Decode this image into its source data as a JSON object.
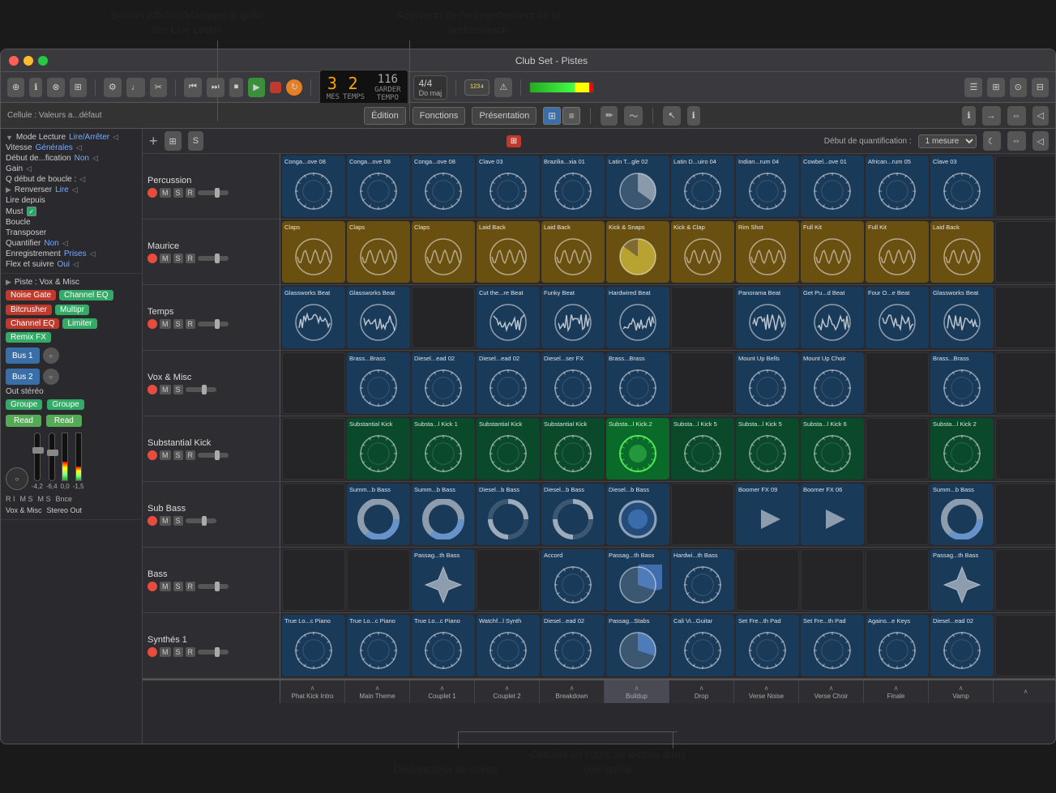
{
  "annotations": {
    "btn_label": "Bouton Afficher/Masquer\nla grille des Live Loops",
    "activation_label": "Activation de l'enregistrement\nde la performance",
    "declencheur_label": "Déclencheur\nde scène",
    "cellules_label": "Cellules en cours de\nlecture dans une scène"
  },
  "titlebar": {
    "title": "Club Set - Pistes"
  },
  "toolbar": {
    "transport": {
      "mes": "MES",
      "temps": "TEMPS",
      "tempo": "TEMPO",
      "counter_mes": "3",
      "counter_temps": "2",
      "tempo_val": "116",
      "time_sig": "4/4",
      "key": "Do maj",
      "garder": "GARDER"
    }
  },
  "sub_toolbar": {
    "edition": "Édition",
    "fonctions": "Fonctions",
    "presentation": "Présentation"
  },
  "left_panel": {
    "cellule_label": "Cellule : Valeurs a...défaut",
    "mode_lecture": "Mode Lecture",
    "mode_value": "Lire/Arrêter",
    "vitesse": "Vitesse",
    "vitesse_value": "Générales",
    "debut_modif": "Début de...fication",
    "debut_modif_value": "Non",
    "gain": "Gain",
    "q_debut": "Q début de boucle :",
    "renverser": "Renverser",
    "renverser_value": "Lire",
    "lire_depuis": "Lire depuis",
    "must": "Must",
    "boucle": "Boucle",
    "transposer": "Transposer",
    "quantifier": "Quantifier",
    "quantifier_value": "Non",
    "enregistrement": "Enregistrement",
    "enregistrement_value": "Prises",
    "flex": "Flex et suivre",
    "flex_value": "Oui",
    "piste_label": "Piste : Vox & Misc",
    "effects": [
      "Noise Gate",
      "Bitcrusher",
      "Channel EQ"
    ],
    "effects2": [
      "Channel EQ",
      "Multipr",
      "Limiter",
      "Remix FX"
    ],
    "bus1": "Bus 1",
    "bus2": "Bus 2",
    "out_stereo": "Out stéréo",
    "groupe": "Groupe",
    "read1": "Read",
    "read2": "Read",
    "val1": "-4,2",
    "val2": "-6,4",
    "val3": "0,0",
    "val4": "-1,5",
    "bottom1": "R I",
    "bottom2": "M S",
    "bottom3": "M S",
    "bounce": "Bnce",
    "track1": "Vox & Misc",
    "track2": "Stereo Out"
  },
  "quantize": {
    "label": "Début de quantification :",
    "value": "1 mesure"
  },
  "tracks": [
    {
      "name": "Percussion",
      "color": "blue",
      "cells": [
        {
          "label": "Conga...ove 08",
          "type": "blue",
          "waveform": "circle"
        },
        {
          "label": "Conga...ove 08",
          "type": "blue",
          "waveform": "circle"
        },
        {
          "label": "Conga...ove 08",
          "type": "blue",
          "waveform": "circle"
        },
        {
          "label": "Clave 03",
          "type": "blue",
          "waveform": "circle"
        },
        {
          "label": "Brazilia...xia 01",
          "type": "blue",
          "waveform": "circle"
        },
        {
          "label": "Latin T...gle 02",
          "type": "blue",
          "waveform": "pie"
        },
        {
          "label": "Latin D...uiro 04",
          "type": "blue",
          "waveform": "circle"
        },
        {
          "label": "Indian...rum 04",
          "type": "blue",
          "waveform": "circle"
        },
        {
          "label": "Cowbel...ove 01",
          "type": "blue",
          "waveform": "circle"
        },
        {
          "label": "African...rum 05",
          "type": "blue",
          "waveform": "circle"
        },
        {
          "label": "Clave 03",
          "type": "blue",
          "waveform": "circle"
        },
        {
          "label": "",
          "type": "empty"
        }
      ]
    },
    {
      "name": "Maurice",
      "color": "yellow",
      "cells": [
        {
          "label": "Claps",
          "type": "gold",
          "waveform": "wave"
        },
        {
          "label": "Claps",
          "type": "gold",
          "waveform": "wave"
        },
        {
          "label": "Claps",
          "type": "gold",
          "waveform": "wave"
        },
        {
          "label": "Laid Back",
          "type": "gold",
          "waveform": "wave"
        },
        {
          "label": "Laid Back",
          "type": "gold",
          "waveform": "wave"
        },
        {
          "label": "Kick & Snaps",
          "type": "gold",
          "waveform": "pie2"
        },
        {
          "label": "Kick & Clap",
          "type": "gold",
          "waveform": "wave"
        },
        {
          "label": "Rim Shot",
          "type": "gold",
          "waveform": "wave"
        },
        {
          "label": "Full Kit",
          "type": "gold",
          "waveform": "wave"
        },
        {
          "label": "Full Kit",
          "type": "gold",
          "waveform": "wave"
        },
        {
          "label": "Laid Back",
          "type": "gold",
          "waveform": "wave"
        },
        {
          "label": "",
          "type": "empty"
        }
      ]
    },
    {
      "name": "Temps",
      "color": "blue",
      "cells": [
        {
          "label": "Glassworks Beat",
          "type": "blue",
          "waveform": "wave2"
        },
        {
          "label": "Glassworks Beat",
          "type": "blue",
          "waveform": "wave2"
        },
        {
          "label": "",
          "type": "empty"
        },
        {
          "label": "Cut the...re Beat",
          "type": "blue",
          "waveform": "wave2"
        },
        {
          "label": "Funky Beat",
          "type": "blue",
          "waveform": "wave2"
        },
        {
          "label": "Hardwired Beat",
          "type": "blue",
          "waveform": "wave2"
        },
        {
          "label": "",
          "type": "empty"
        },
        {
          "label": "Panorama Beat",
          "type": "blue",
          "waveform": "wave2"
        },
        {
          "label": "Get Pu...d Beat",
          "type": "blue",
          "waveform": "wave2"
        },
        {
          "label": "Four O...e Beat",
          "type": "blue",
          "waveform": "wave2"
        },
        {
          "label": "Glassworks Beat",
          "type": "blue",
          "waveform": "wave2"
        },
        {
          "label": "",
          "type": "empty"
        }
      ]
    },
    {
      "name": "Vox & Misc",
      "color": "blue",
      "cells": [
        {
          "label": "",
          "type": "empty"
        },
        {
          "label": "Brass...Brass",
          "type": "blue",
          "waveform": "circle"
        },
        {
          "label": "Diesel...ead 02",
          "type": "blue",
          "waveform": "circle"
        },
        {
          "label": "Diesel...ead 02",
          "type": "blue",
          "waveform": "circle"
        },
        {
          "label": "Diesel...ser FX",
          "type": "blue",
          "waveform": "circle"
        },
        {
          "label": "Brass...Brass",
          "type": "blue",
          "waveform": "circle"
        },
        {
          "label": "",
          "type": "empty"
        },
        {
          "label": "Mount Up Bells",
          "type": "blue",
          "waveform": "circle"
        },
        {
          "label": "Mount Up Choir",
          "type": "blue",
          "waveform": "circle"
        },
        {
          "label": "",
          "type": "empty"
        },
        {
          "label": "Brass...Brass",
          "type": "blue",
          "waveform": "circle"
        },
        {
          "label": "",
          "type": "empty"
        }
      ]
    },
    {
      "name": "Substantial Kick",
      "color": "green",
      "cells": [
        {
          "label": "",
          "type": "empty"
        },
        {
          "label": "Substantial Kick",
          "type": "green",
          "waveform": "circle"
        },
        {
          "label": "Substa...l Kick 1",
          "type": "green",
          "waveform": "circle"
        },
        {
          "label": "Substantial Kick",
          "type": "green",
          "waveform": "circle"
        },
        {
          "label": "Substantial Kick",
          "type": "green",
          "waveform": "circle"
        },
        {
          "label": "Substa...l Kick.2",
          "type": "bright-green",
          "waveform": "circle-bright"
        },
        {
          "label": "Substa...l Kick 5",
          "type": "green",
          "waveform": "circle"
        },
        {
          "label": "Substa...l Kick 5",
          "type": "green",
          "waveform": "circle"
        },
        {
          "label": "Substa...l Kick 6",
          "type": "green",
          "waveform": "circle"
        },
        {
          "label": "",
          "type": "empty"
        },
        {
          "label": "Substa...l Kick 2",
          "type": "green",
          "waveform": "circle"
        },
        {
          "label": "",
          "type": "empty"
        }
      ]
    },
    {
      "name": "Sub Bass",
      "color": "blue",
      "cells": [
        {
          "label": "",
          "type": "empty"
        },
        {
          "label": "Summ...b Bass",
          "type": "blue",
          "waveform": "donut"
        },
        {
          "label": "Summ...b Bass",
          "type": "blue",
          "waveform": "donut"
        },
        {
          "label": "Diesel...b Bass",
          "type": "blue",
          "waveform": "donut-open"
        },
        {
          "label": "Diesel...b Bass",
          "type": "blue",
          "waveform": "donut-open"
        },
        {
          "label": "Diesel...b Bass",
          "type": "blue",
          "waveform": "donut-fill"
        },
        {
          "label": "",
          "type": "empty"
        },
        {
          "label": "Boomer FX 09",
          "type": "blue",
          "waveform": "play"
        },
        {
          "label": "Boomer FX 06",
          "type": "blue",
          "waveform": "play"
        },
        {
          "label": "",
          "type": "empty"
        },
        {
          "label": "Summ...b Bass",
          "type": "blue",
          "waveform": "donut"
        },
        {
          "label": "",
          "type": "empty"
        }
      ]
    },
    {
      "name": "Bass",
      "color": "blue",
      "cells": [
        {
          "label": "",
          "type": "empty"
        },
        {
          "label": "",
          "type": "empty"
        },
        {
          "label": "Passag...th Bass",
          "type": "blue",
          "waveform": "star"
        },
        {
          "label": "",
          "type": "empty"
        },
        {
          "label": "Accord",
          "type": "blue",
          "waveform": "circle"
        },
        {
          "label": "Passag...th Bass",
          "type": "blue",
          "waveform": "pie3"
        },
        {
          "label": "Hardwi...th Bass",
          "type": "blue",
          "waveform": "circle"
        },
        {
          "label": "",
          "type": "empty"
        },
        {
          "label": "",
          "type": "empty"
        },
        {
          "label": "",
          "type": "empty"
        },
        {
          "label": "Passag...th Bass",
          "type": "blue",
          "waveform": "star"
        },
        {
          "label": "",
          "type": "empty"
        }
      ]
    },
    {
      "name": "Synthés 1",
      "color": "blue",
      "cells": [
        {
          "label": "True Lo...c Piano",
          "type": "blue",
          "waveform": "circle"
        },
        {
          "label": "True Lo...c Piano",
          "type": "blue",
          "waveform": "circle"
        },
        {
          "label": "True Lo...c Piano",
          "type": "blue",
          "waveform": "circle"
        },
        {
          "label": "Watchf...l Synth",
          "type": "blue",
          "waveform": "circle"
        },
        {
          "label": "Diesel...ead 02",
          "type": "blue",
          "waveform": "circle"
        },
        {
          "label": "Passag...Stabs",
          "type": "blue",
          "waveform": "pie4"
        },
        {
          "label": "Cali Vi...Guitar",
          "type": "blue",
          "waveform": "circle"
        },
        {
          "label": "Set Fre...th Pad",
          "type": "blue",
          "waveform": "circle"
        },
        {
          "label": "Set Fre...th Pad",
          "type": "blue",
          "waveform": "circle"
        },
        {
          "label": "Agains...e Keys",
          "type": "blue",
          "waveform": "circle"
        },
        {
          "label": "Diesel...ead 02",
          "type": "blue",
          "waveform": "circle"
        },
        {
          "label": "",
          "type": "empty"
        }
      ]
    }
  ],
  "scenes": [
    {
      "name": "Phat Kick Intro",
      "active": false
    },
    {
      "name": "Main Theme",
      "active": false
    },
    {
      "name": "Couplet 1",
      "active": false
    },
    {
      "name": "Couplet 2",
      "active": false
    },
    {
      "name": "Breakdown",
      "active": false
    },
    {
      "name": "Buildup",
      "active": true
    },
    {
      "name": "Drop",
      "active": false
    },
    {
      "name": "Verse Noise",
      "active": false
    },
    {
      "name": "Verse Choir",
      "active": false
    },
    {
      "name": "Finale",
      "active": false
    },
    {
      "name": "Vamp",
      "active": false
    },
    {
      "name": "",
      "active": false
    }
  ]
}
